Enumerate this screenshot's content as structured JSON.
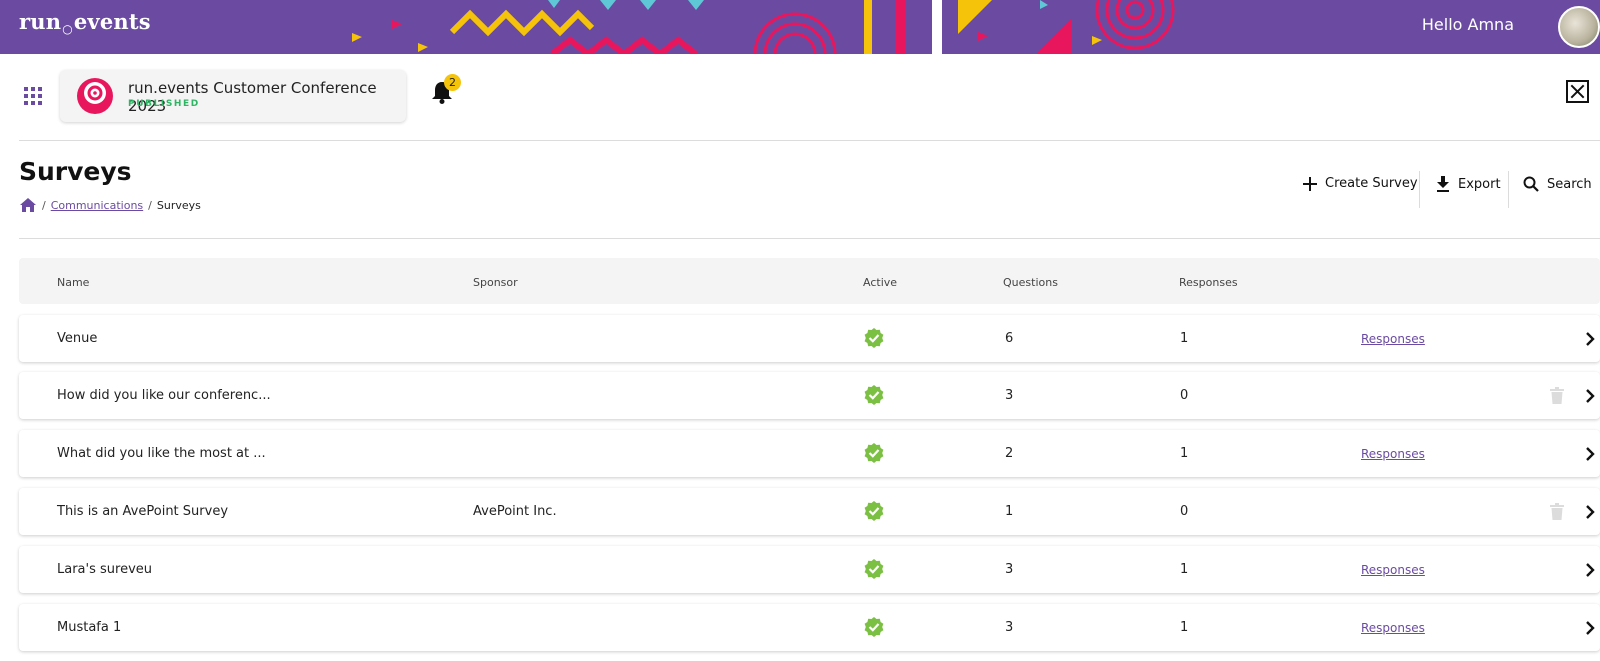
{
  "header": {
    "logo_text": "run",
    "logo_text_2": "events",
    "greeting": "Hello Amna"
  },
  "event": {
    "title": "run.events Customer Conference 2023",
    "status": "PUBLISHED",
    "notification_count": "2"
  },
  "page": {
    "title": "Surveys",
    "breadcrumb": {
      "sep1": "/",
      "parent": "Communications",
      "sep2": "/",
      "current": "Surveys"
    },
    "actions": {
      "create": "Create Survey",
      "export": "Export",
      "search": "Search"
    }
  },
  "table": {
    "columns": {
      "name": "Name",
      "sponsor": "Sponsor",
      "active": "Active",
      "questions": "Questions",
      "responses": "Responses"
    },
    "rows": [
      {
        "name": "Venue",
        "sponsor": "",
        "active": true,
        "questions": "6",
        "responses": "1",
        "link": "Responses",
        "deletable": false
      },
      {
        "name": "How did you like our conferenc...",
        "sponsor": "",
        "active": true,
        "questions": "3",
        "responses": "0",
        "link": "",
        "deletable": true
      },
      {
        "name": "What did you like the most at ...",
        "sponsor": "",
        "active": true,
        "questions": "2",
        "responses": "1",
        "link": "Responses",
        "deletable": false
      },
      {
        "name": "This is an AvePoint Survey",
        "sponsor": "AvePoint Inc.",
        "active": true,
        "questions": "1",
        "responses": "0",
        "link": "",
        "deletable": true
      },
      {
        "name": "Lara's sureveu",
        "sponsor": "",
        "active": true,
        "questions": "3",
        "responses": "1",
        "link": "Responses",
        "deletable": false
      },
      {
        "name": "Mustafa 1",
        "sponsor": "",
        "active": true,
        "questions": "3",
        "responses": "1",
        "link": "Responses",
        "deletable": false
      }
    ]
  },
  "colors": {
    "brand": "#6b4ba1",
    "published": "#2db563",
    "active_check": "#7cc043",
    "badge": "#f5c40a"
  },
  "icons": {
    "apps": "apps-grid-icon",
    "bell": "bell-icon",
    "close": "close-icon",
    "home": "home-icon",
    "create": "plus-icon",
    "export": "download-icon",
    "search": "search-icon",
    "active": "verified-check-icon",
    "delete": "trash-icon",
    "open": "chevron-right-icon"
  }
}
